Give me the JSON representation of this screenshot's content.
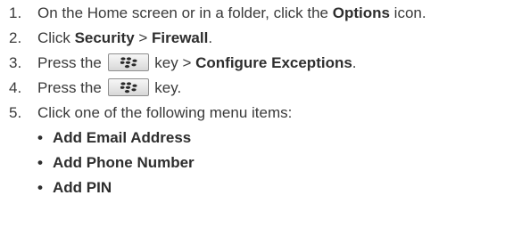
{
  "steps": [
    {
      "num": "1.",
      "before": "On the Home screen or in a folder, click the ",
      "bold": "Options",
      "after": " icon."
    },
    {
      "num": "2.",
      "bold1": "Security",
      "sep": " > ",
      "bold2": "Firewall",
      "after": "."
    },
    {
      "num": "3.",
      "before": "Press the ",
      "key": "blackberry-menu-key",
      "after": " key > ",
      "bold": "Configure Exceptions",
      "end": "."
    },
    {
      "num": "4.",
      "before": "Press the ",
      "key": "blackberry-menu-key",
      "after": " key."
    },
    {
      "num": "5.",
      "text": "Click one of the following menu items:"
    }
  ],
  "step2_prefix": "Click ",
  "menu_items": [
    "Add Email Address",
    "Add Phone Number",
    "Add PIN"
  ],
  "bullet": "•",
  "colors": {
    "text": "#3a3a3a",
    "key_border": "#8e8e8e"
  }
}
